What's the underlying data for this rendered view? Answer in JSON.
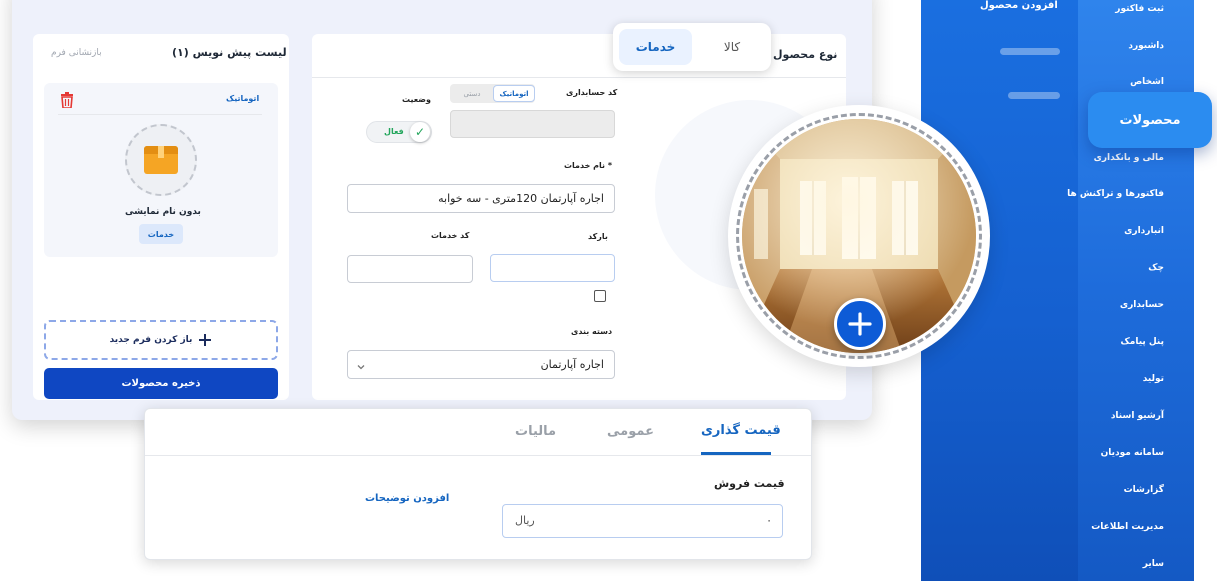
{
  "sidebar": {
    "header": "افزودن محصول",
    "items": [
      {
        "label": "ثبت فاکتور"
      },
      {
        "label": "داشبورد"
      },
      {
        "label": "اشخاص"
      },
      {
        "label": "مالی و بانکداری"
      },
      {
        "label": "فاکتورها و تراکنش ها"
      },
      {
        "label": "انبارداری"
      },
      {
        "label": "چک"
      },
      {
        "label": "حسابداری"
      },
      {
        "label": "پنل پیامک"
      },
      {
        "label": "تولید"
      },
      {
        "label": "آرشیو اسناد"
      },
      {
        "label": "سامانه مودیان"
      },
      {
        "label": "گزارشات"
      },
      {
        "label": "مدیریت اطلاعات"
      },
      {
        "label": "سایر"
      }
    ],
    "active_label": "محصولات"
  },
  "drafts": {
    "title": "لیست پیش نویس (۱)",
    "reset_label": "بازنشانی فرم",
    "item": {
      "mode": "اتوماتیک",
      "name": "بدون نام نمایشی",
      "type_chip": "خدمات"
    },
    "new_form_label": "باز کردن فرم جدید",
    "save_label": "ذخیره محصولات"
  },
  "form": {
    "product_type_label": "نوع محصول",
    "tabs": [
      "کالا",
      "خدمات"
    ],
    "active_tab": "خدمات",
    "accounting_code_label": "کد حسابداری",
    "code_modes": [
      "اتوماتیک",
      "دستی"
    ],
    "status_label": "وضعیت",
    "status_value": "فعال",
    "service_name_label": "نام خدمات *",
    "service_name_value": "اجاره آپارتمان 120متری - سه خوابه",
    "barcode_label": "بارکد",
    "service_code_label": "کد خدمات",
    "category_label": "دسته بندی",
    "category_value": "اجاره آپارتمان"
  },
  "pricing": {
    "tabs": [
      "قیمت گذاری",
      "عمومی",
      "مالیات"
    ],
    "sale_price_label": "قیمت فروش",
    "sale_price_value": "۰",
    "currency": "ریال",
    "add_description_label": "افزودن توضیحات"
  },
  "colors": {
    "brand_blue": "#1565c0",
    "primary_button": "#0f47c2",
    "active_green": "#22a55b",
    "trash_red": "#e53935"
  }
}
